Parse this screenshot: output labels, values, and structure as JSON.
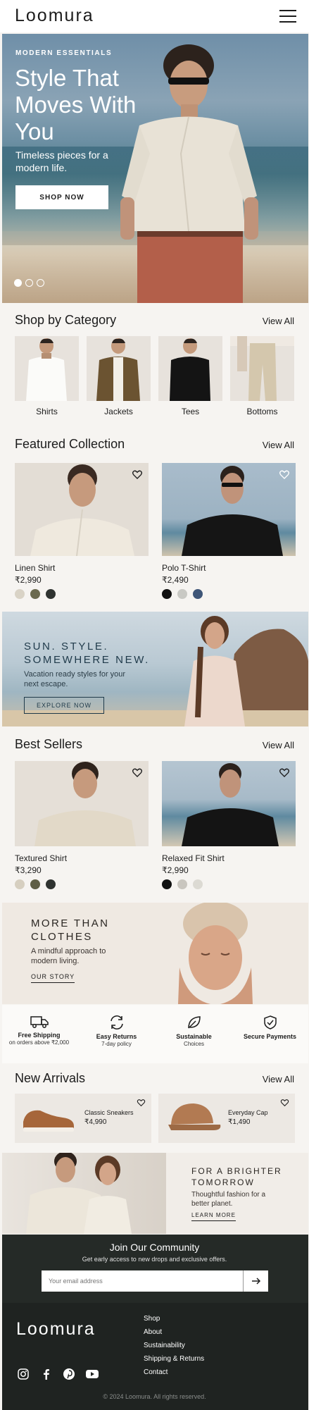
{
  "header": {
    "logo": "Loomura",
    "menu_icon": "hamburger-menu-icon"
  },
  "hero": {
    "kicker": "MODERN ESSENTIALS",
    "title": "Style That Moves With You",
    "subtitle": "Timeless pieces for a modern life.",
    "cta": "SHOP NOW",
    "slides": 3,
    "active_slide": 1
  },
  "categories": {
    "title": "Shop by Category",
    "view_all": "View All",
    "items": [
      {
        "label": "Shirts"
      },
      {
        "label": "Jackets"
      },
      {
        "label": "Tees"
      },
      {
        "label": "Bottoms"
      }
    ]
  },
  "featured": {
    "title": "Featured Collection",
    "view_all": "View All",
    "products": [
      {
        "name": "Linen Shirt",
        "price": "₹2,990",
        "swatches": [
          "#d9d3c6",
          "#6b6a4f",
          "#2f3330"
        ]
      },
      {
        "name": "Polo T-Shirt",
        "price": "₹2,490",
        "swatches": [
          "#111111",
          "#c9c9c4",
          "#3e5577"
        ]
      }
    ]
  },
  "banner_summer": {
    "title_line1": "SUN. STYLE.",
    "title_line2": "SOMEWHERE NEW.",
    "subtitle": "Vacation ready styles for your next escape.",
    "cta": "EXPLORE NOW"
  },
  "best_sellers": {
    "title": "Best Sellers",
    "view_all": "View All",
    "products": [
      {
        "name": "Textured Shirt",
        "price": "₹3,290",
        "swatches": [
          "#d6cfc0",
          "#5f5e45",
          "#2f3330"
        ]
      },
      {
        "name": "Relaxed Fit Shirt",
        "price": "₹2,990",
        "swatches": [
          "#111111",
          "#c9c6bf",
          "#dcdad3"
        ]
      }
    ]
  },
  "banner_story": {
    "title_line1": "MORE THAN",
    "title_line2": "CLOTHES",
    "subtitle": "A mindful approach to modern living.",
    "cta": "OUR STORY"
  },
  "features": [
    {
      "icon": "truck-icon",
      "title": "Free Shipping",
      "subtitle": "on orders above ₹2,000"
    },
    {
      "icon": "returns-icon",
      "title": "Easy Returns",
      "subtitle": "7-day policy"
    },
    {
      "icon": "leaf-icon",
      "title": "Sustainable",
      "subtitle": "Choices"
    },
    {
      "icon": "shield-check-icon",
      "title": "Secure Payments",
      "subtitle": ""
    }
  ],
  "new_arrivals": {
    "title": "New Arrivals",
    "view_all": "View All",
    "products": [
      {
        "name": "Classic Sneakers",
        "price": "₹4,990"
      },
      {
        "name": "Everyday Cap",
        "price": "₹1,490"
      }
    ]
  },
  "banner_planet": {
    "title_line1": "FOR A BRIGHTER",
    "title_line2": "TOMORROW",
    "subtitle": "Thoughtful fashion for a better planet.",
    "cta": "LEARN MORE"
  },
  "community": {
    "title": "Join Our Community",
    "subtitle": "Get early access to new drops and exclusive offers.",
    "email_placeholder": "Your email address",
    "submit_icon": "arrow-right-icon"
  },
  "footer": {
    "logo": "Loomura",
    "links": [
      "Shop",
      "About",
      "Sustainability",
      "Shipping & Returns",
      "Contact"
    ],
    "social": [
      "instagram-icon",
      "facebook-icon",
      "pinterest-icon",
      "youtube-icon"
    ],
    "copyright": "© 2024 Loomura. All rights reserved."
  },
  "colors": {
    "background": "#f6f4f1",
    "dark": "#252a27",
    "footer": "#1f2321",
    "accent_blue": "#1f3a4a"
  }
}
